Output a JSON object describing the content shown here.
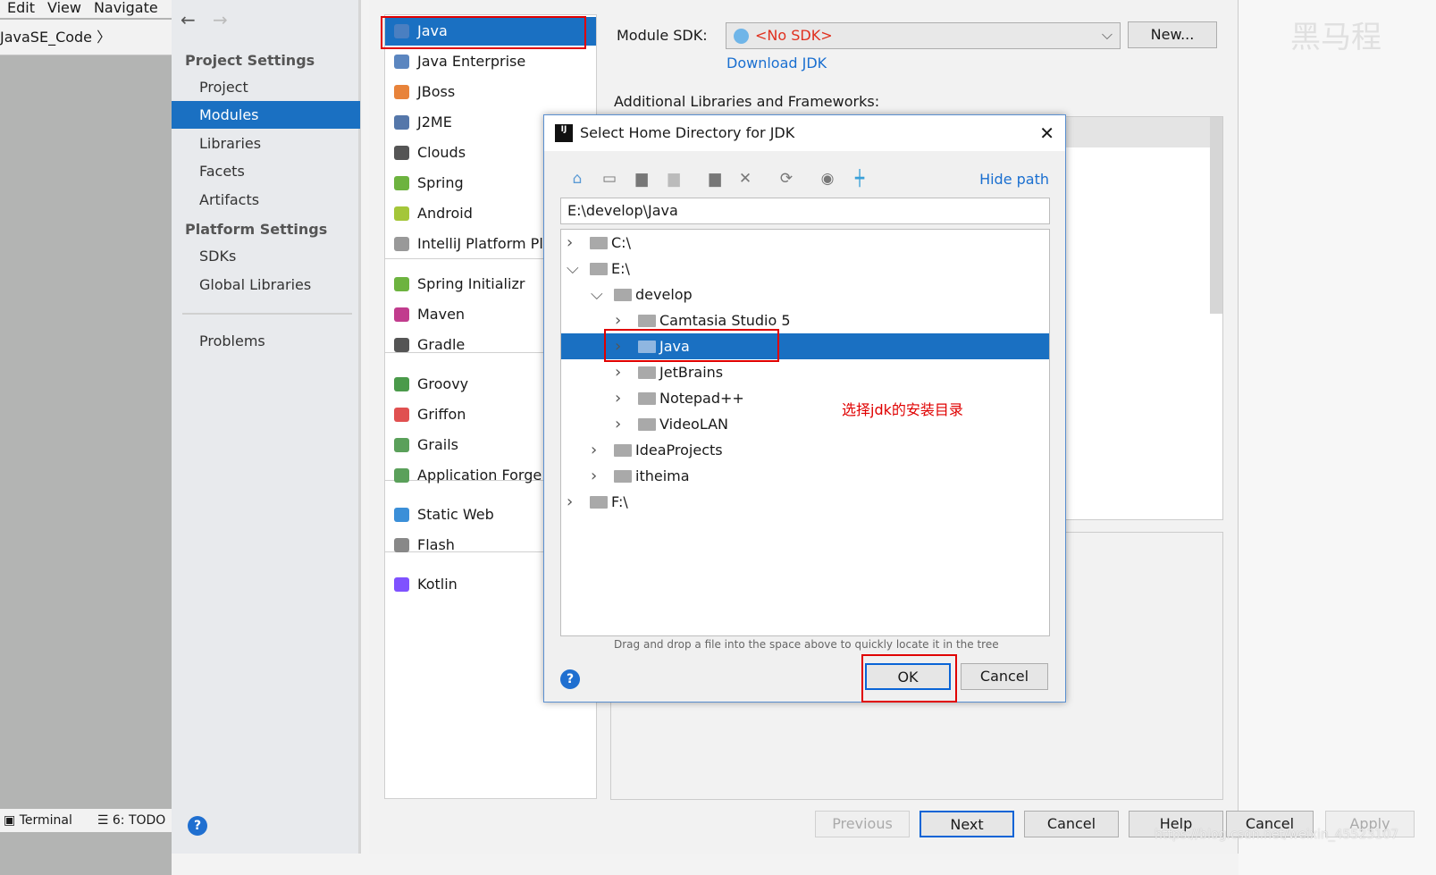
{
  "ide": {
    "menu": [
      "Edit",
      "View",
      "Navigate"
    ],
    "breadcrumb": "JavaSE_Code",
    "bottom": [
      "Terminal",
      "6: TODO"
    ]
  },
  "project_structure": {
    "groups": [
      {
        "title": "Project Settings",
        "items": [
          "Project",
          "Modules",
          "Libraries",
          "Facets",
          "Artifacts"
        ]
      },
      {
        "title": "Platform Settings",
        "items": [
          "SDKs",
          "Global Libraries"
        ]
      }
    ],
    "problems": "Problems",
    "selected": "Modules"
  },
  "new_project": {
    "types": [
      "Java",
      "Java Enterprise",
      "JBoss",
      "J2ME",
      "Clouds",
      "Spring",
      "Android",
      "IntelliJ Platform Plugin",
      "Spring Initializr",
      "Maven",
      "Gradle",
      "Groovy",
      "Griffon",
      "Grails",
      "Application Forge",
      "Static Web",
      "Flash",
      "Kotlin"
    ],
    "selected_type": "Java",
    "module_sdk_label": "Module SDK:",
    "sdk_value": "<No SDK>",
    "new_button": "New...",
    "download_jdk": "Download JDK",
    "libs_label": "Additional Libraries and Frameworks:",
    "buttons": {
      "previous": "Previous",
      "next": "Next",
      "cancel": "Cancel",
      "help": "Help"
    }
  },
  "outer_buttons": {
    "cancel": "Cancel",
    "apply": "Apply"
  },
  "dialog": {
    "title": "Select Home Directory for JDK",
    "hide_path": "Hide path",
    "path": "E:\\develop\\Java",
    "tree": [
      {
        "label": "C:\\",
        "depth": 0,
        "state": "collapsed"
      },
      {
        "label": "E:\\",
        "depth": 0,
        "state": "expanded"
      },
      {
        "label": "develop",
        "depth": 1,
        "state": "expanded"
      },
      {
        "label": "Camtasia Studio 5",
        "depth": 2,
        "state": "collapsed"
      },
      {
        "label": "Java",
        "depth": 2,
        "state": "collapsed",
        "selected": true
      },
      {
        "label": "JetBrains",
        "depth": 2,
        "state": "collapsed"
      },
      {
        "label": "Notepad++",
        "depth": 2,
        "state": "collapsed"
      },
      {
        "label": "VideoLAN",
        "depth": 2,
        "state": "collapsed"
      },
      {
        "label": "IdeaProjects",
        "depth": 1,
        "state": "collapsed"
      },
      {
        "label": "itheima",
        "depth": 1,
        "state": "collapsed"
      },
      {
        "label": "F:\\",
        "depth": 0,
        "state": "collapsed"
      }
    ],
    "annotation": "选择jdk的安装目录",
    "hint": "Drag and drop a file into the space above to quickly locate it in the tree",
    "ok": "OK",
    "cancel": "Cancel"
  },
  "watermark": "https://blog.csdn.net/weixin_45523107",
  "logo_text": "黑马程序员",
  "colors": {
    "selection": "#1a70c2",
    "link": "#1a6fd0",
    "highlight_box": "#e00000",
    "sdk_error": "#e0301e"
  }
}
